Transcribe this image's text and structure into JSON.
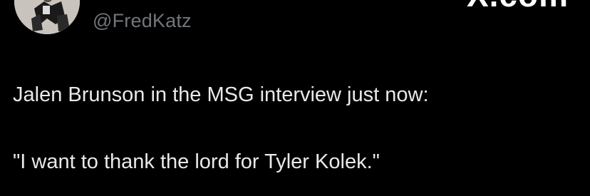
{
  "tweet": {
    "handle": "@FredKatz",
    "watermark": "X.com",
    "lines": [
      "Jalen Brunson in the MSG interview just now:",
      "\"I want to thank the lord for Tyler Kolek.\""
    ]
  },
  "colors": {
    "background": "#000000",
    "text": "#e7e9ea",
    "handle": "#71767b"
  },
  "icons": {
    "avatar": "profile-photo"
  }
}
